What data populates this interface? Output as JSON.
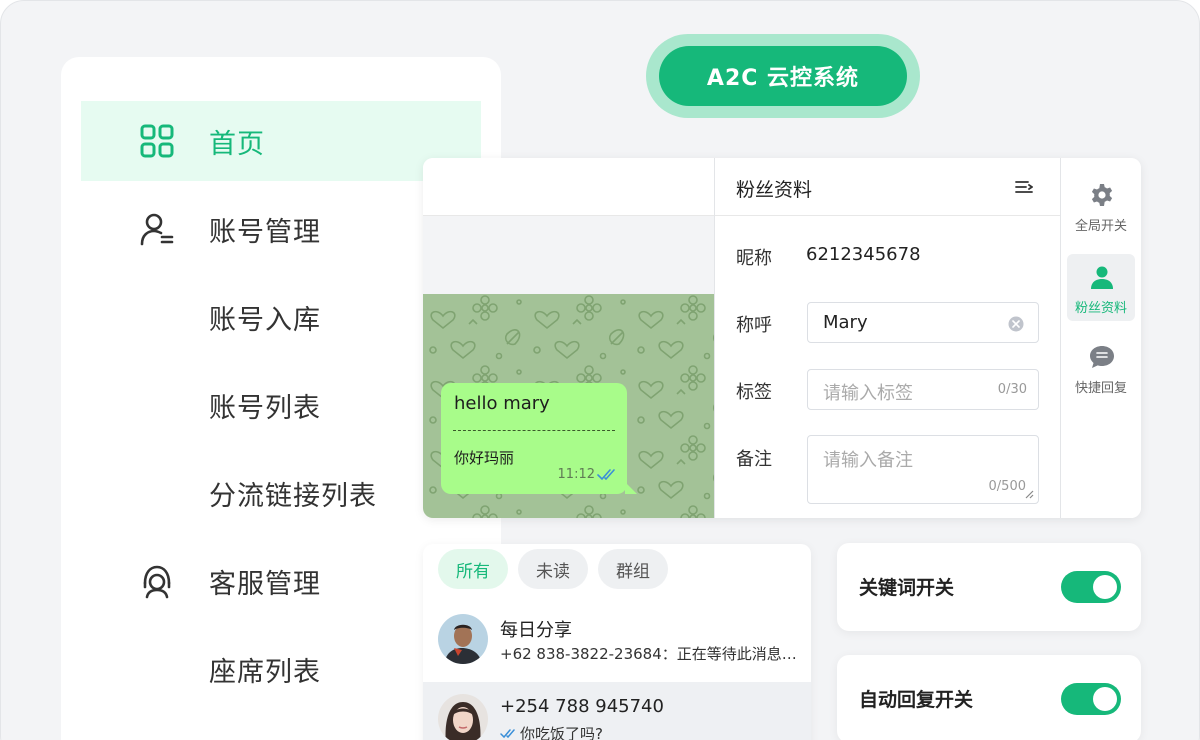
{
  "app": {
    "title": "A2C 云控系统"
  },
  "sidebar": {
    "items": [
      {
        "label": "首页",
        "icon": "grid-icon",
        "active": true
      },
      {
        "label": "账号管理",
        "icon": "user-list-icon"
      },
      {
        "label": "账号入库"
      },
      {
        "label": "账号列表"
      },
      {
        "label": "分流链接列表"
      },
      {
        "label": "客服管理",
        "icon": "headset-icon"
      },
      {
        "label": "座席列表"
      }
    ]
  },
  "chat": {
    "bubble": {
      "text": "hello mary",
      "translation": "你好玛丽",
      "time": "11:12"
    }
  },
  "profile": {
    "title": "粉丝资料",
    "nickname_label": "昵称",
    "nickname_value": "6212345678",
    "salutation_label": "称呼",
    "salutation_value": "Mary",
    "tag_label": "标签",
    "tag_placeholder": "请输入标签",
    "tag_count": "0/30",
    "note_label": "备注",
    "note_placeholder": "请输入备注",
    "note_count": "0/500"
  },
  "rail": {
    "items": [
      {
        "label": "全局开关",
        "icon": "gear-icon"
      },
      {
        "label": "粉丝资料",
        "icon": "person-icon",
        "active": true
      },
      {
        "label": "快捷回复",
        "icon": "chat-bubble-icon"
      }
    ]
  },
  "conversation_list": {
    "filters": [
      "所有",
      "未读",
      "群组"
    ],
    "items": [
      {
        "name": "每日分享",
        "message": "+62 838-3822-23684：正在等待此消息的..."
      },
      {
        "name": "+254 788 945740",
        "message": "你吃饭了吗?"
      }
    ]
  },
  "toggles": [
    {
      "label": "关键词开关",
      "on": true
    },
    {
      "label": "自动回复开关",
      "on": true
    }
  ],
  "colors": {
    "accent": "#16b87a",
    "accent_light": "#e6fbf1",
    "bubble": "#a8fc8a",
    "chat_bg": "#a3c297"
  }
}
